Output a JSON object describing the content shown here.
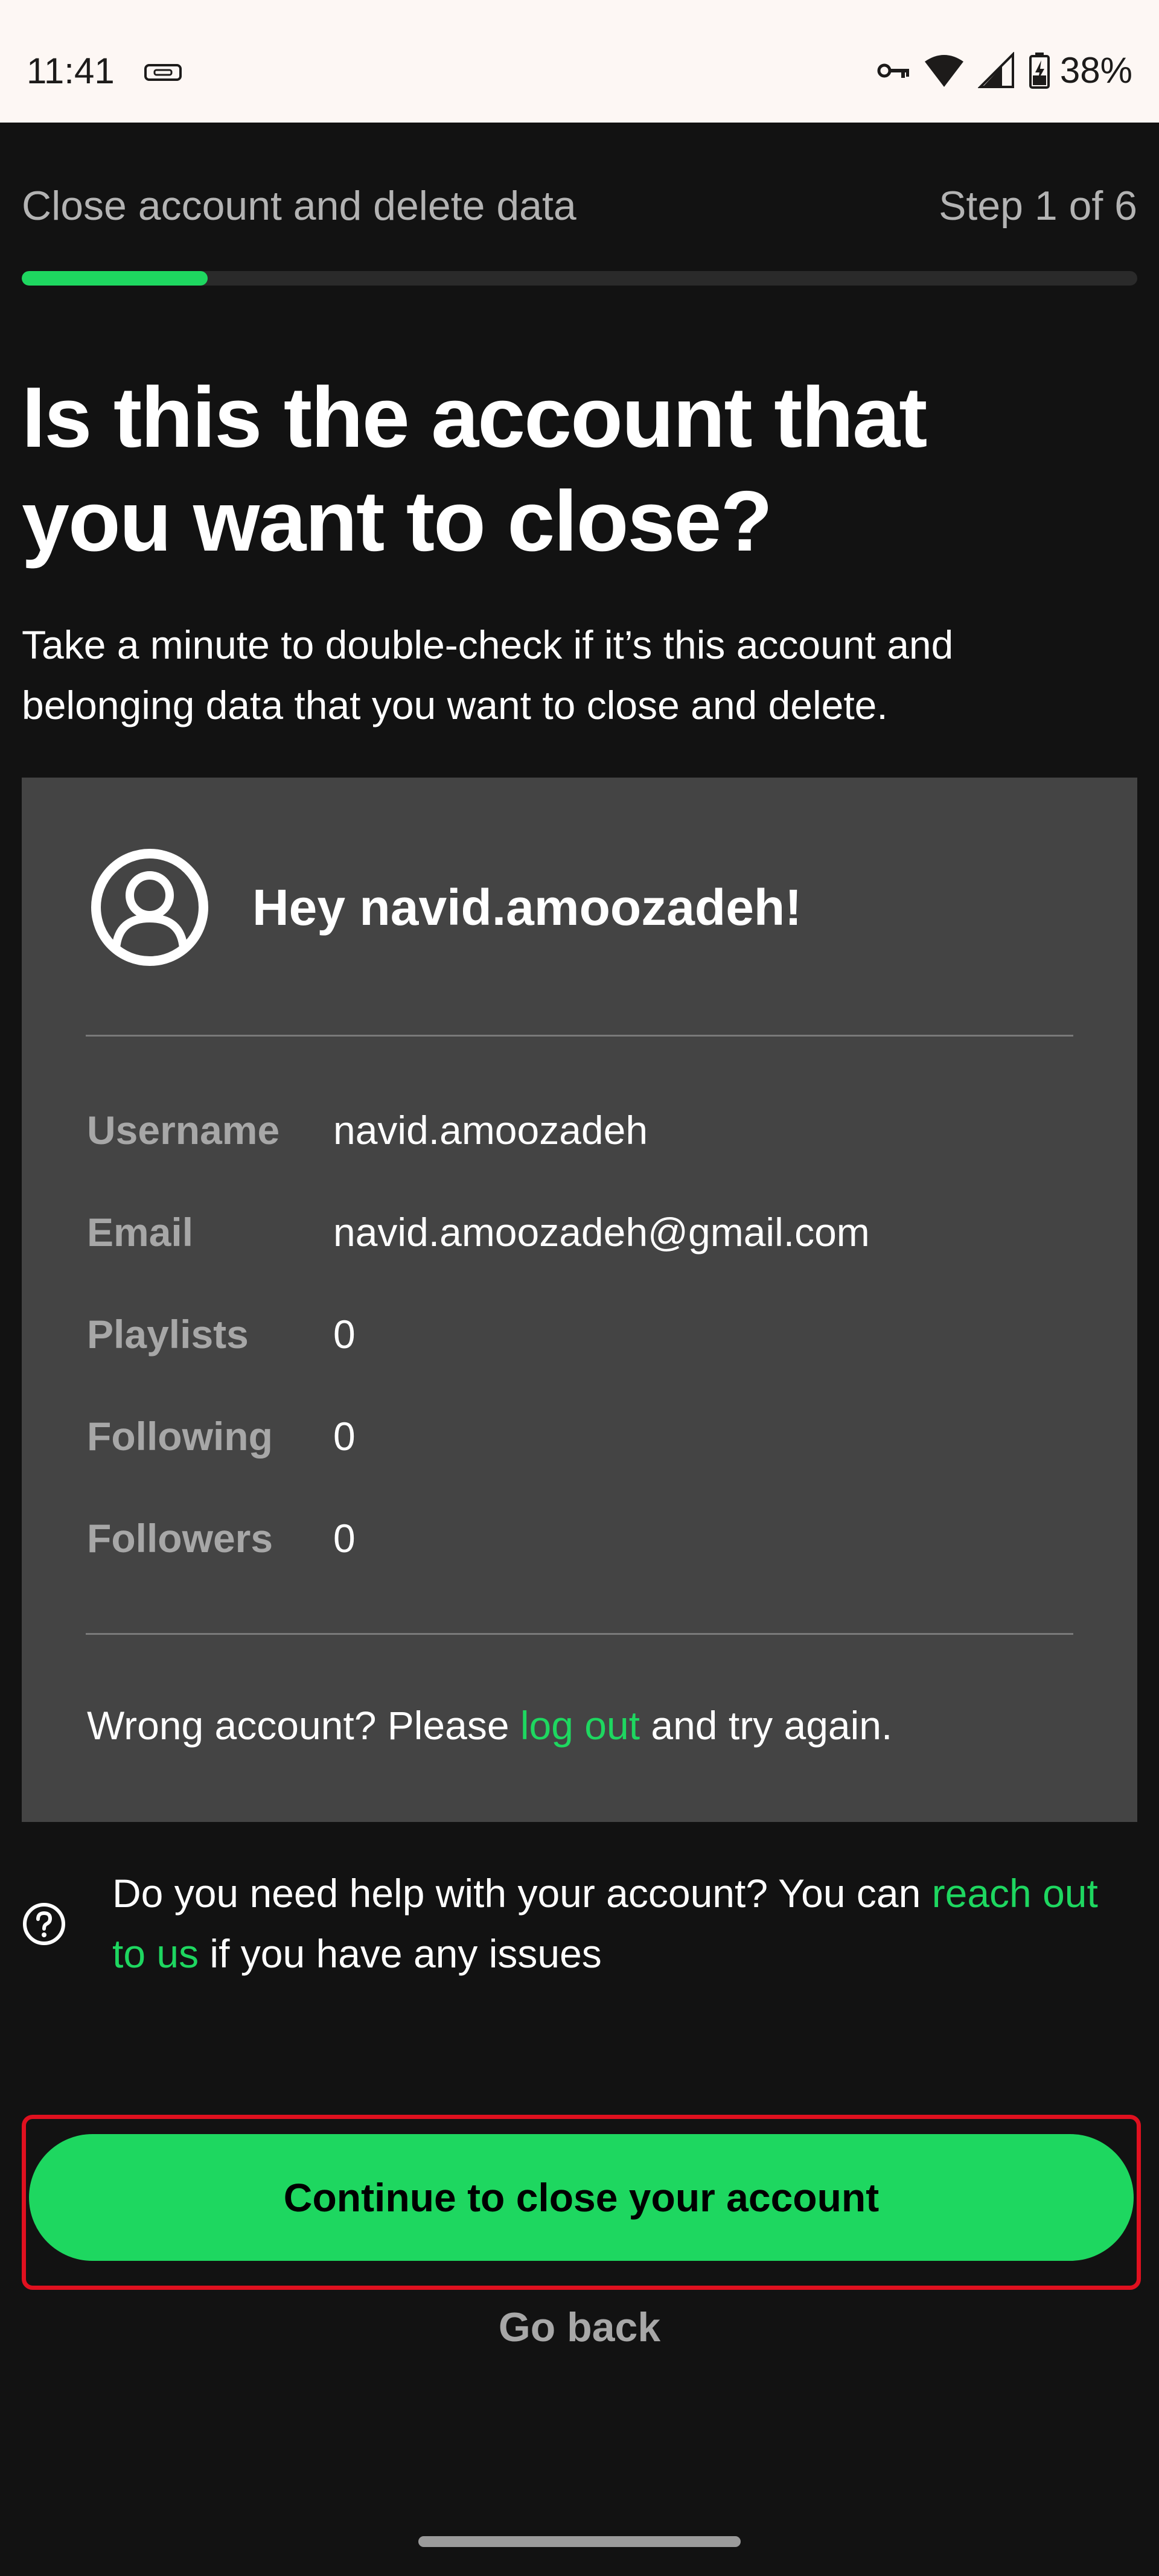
{
  "status_bar": {
    "time": "11:41",
    "battery_percent": "38%",
    "icons": [
      "link-icon",
      "vpn-key-icon",
      "wifi-icon",
      "signal-icon",
      "battery-charging-icon"
    ]
  },
  "header": {
    "title": "Close account and delete data",
    "step": "Step 1 of 6",
    "progress_fraction": 0.1667
  },
  "main": {
    "headline": "Is this the account that you want to close?",
    "subtext": "Take a minute to double-check if it’s this account and belonging data that you want to close and delete."
  },
  "account_card": {
    "greeting": "Hey navid.amoozadeh!",
    "rows": [
      {
        "label": "Username",
        "value": "navid.amoozadeh"
      },
      {
        "label": "Email",
        "value": "navid.amoozadeh@gmail.com"
      },
      {
        "label": "Playlists",
        "value": "0"
      },
      {
        "label": "Following",
        "value": "0"
      },
      {
        "label": "Followers",
        "value": "0"
      }
    ],
    "wrong_account": {
      "before": "Wrong account? Please ",
      "link": "log out",
      "after": " and try again."
    }
  },
  "help": {
    "before": "Do you need help with your account? You can ",
    "link": "reach out to us",
    "after": " if you have any issues"
  },
  "actions": {
    "primary_label": "Continue to close your account",
    "secondary_label": "Go back"
  },
  "colors": {
    "accent": "#1ed760",
    "background": "#121212",
    "card": "#444444",
    "highlight": "#e0101f",
    "status_bar": "#fdf7f4"
  }
}
